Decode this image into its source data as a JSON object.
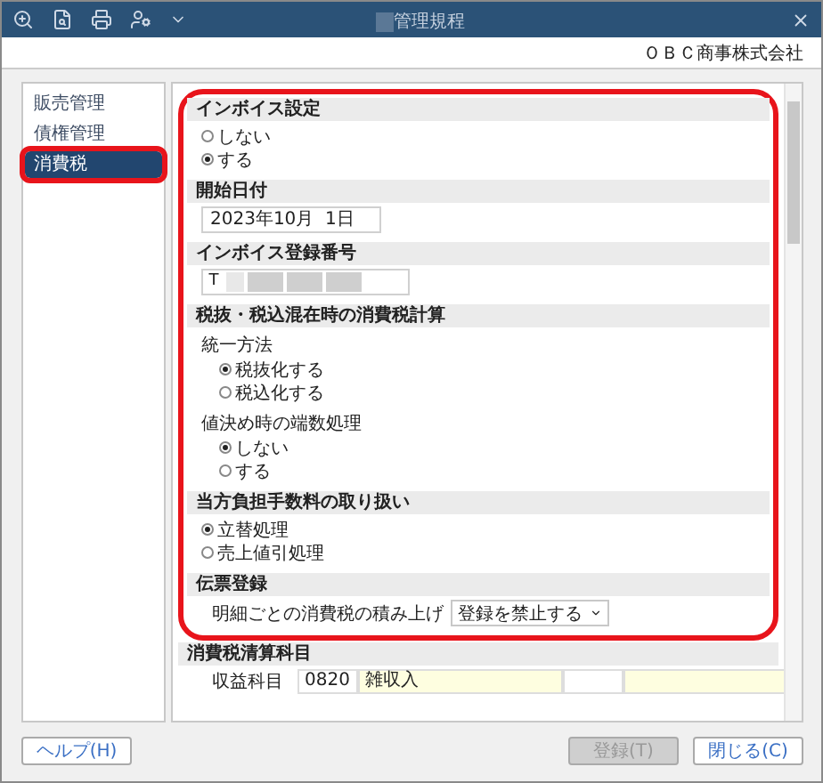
{
  "window": {
    "title": "管理規程"
  },
  "company": "ＯＢＣ商事株式会社",
  "sidebar": {
    "items": [
      {
        "label": "販売管理",
        "selected": false,
        "outlined": false
      },
      {
        "label": "債権管理",
        "selected": false,
        "outlined": false
      },
      {
        "label": "消費税",
        "selected": true,
        "outlined": true
      }
    ]
  },
  "content": {
    "highlighted_sections": [
      {
        "kind": "radio",
        "title": "インボイス設定",
        "groups": [
          {
            "options": [
              {
                "label": "しない",
                "selected": false
              },
              {
                "label": "する",
                "selected": true
              }
            ]
          }
        ]
      },
      {
        "kind": "date",
        "title": "開始日付",
        "value": "2023年10月  1日"
      },
      {
        "kind": "regno",
        "title": "インボイス登録番号",
        "prefix": "T"
      },
      {
        "kind": "radio",
        "title": "税抜・税込混在時の消費税計算",
        "groups": [
          {
            "label": "統一方法",
            "options": [
              {
                "label": "税抜化する",
                "selected": true
              },
              {
                "label": "税込化する",
                "selected": false
              }
            ]
          },
          {
            "label": "値決め時の端数処理",
            "options": [
              {
                "label": "しない",
                "selected": true
              },
              {
                "label": "する",
                "selected": false
              }
            ]
          }
        ]
      },
      {
        "kind": "radio",
        "title": "当方負担手数料の取り扱い",
        "groups": [
          {
            "options": [
              {
                "label": "立替処理",
                "selected": true
              },
              {
                "label": "売上値引処理",
                "selected": false
              }
            ]
          }
        ]
      },
      {
        "kind": "select",
        "title": "伝票登録",
        "label": "明細ごとの消費税の積み上げ",
        "value": "登録を禁止する"
      }
    ],
    "other_sections": [
      {
        "kind": "account",
        "title": "消費税清算科目",
        "label": "収益科目",
        "code": "0820",
        "name": "雑収入"
      }
    ]
  },
  "buttons": [
    {
      "label": "ヘルプ(H)",
      "disabled": false
    },
    {
      "label": "登録(T)",
      "disabled": true
    },
    {
      "label": "閉じる(C)",
      "disabled": false
    }
  ]
}
